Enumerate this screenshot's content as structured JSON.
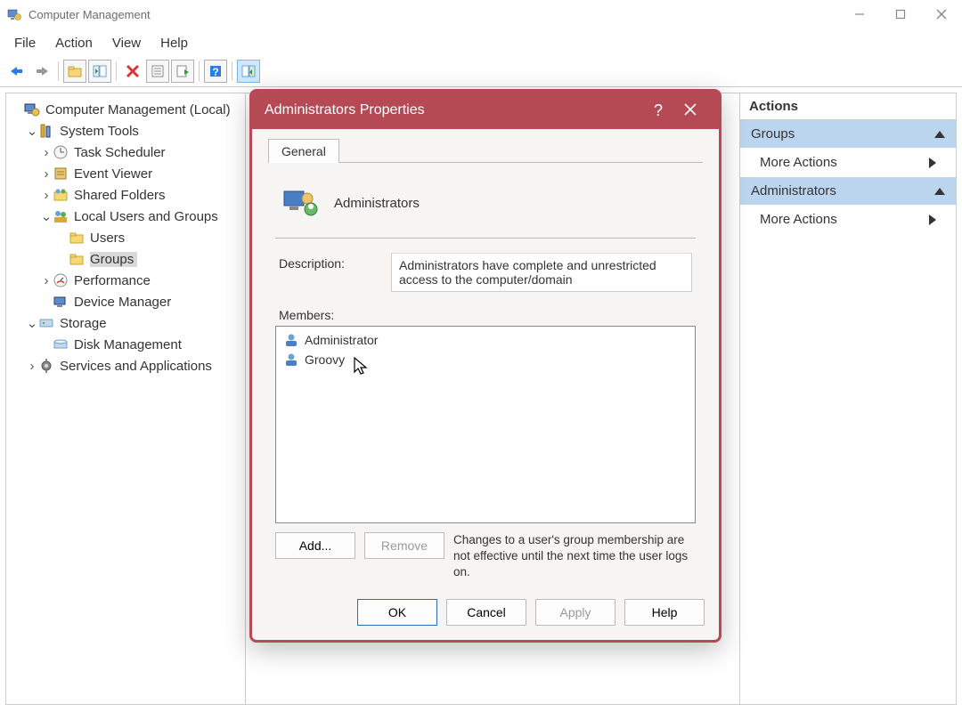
{
  "window": {
    "title": "Computer Management",
    "menus": [
      "File",
      "Action",
      "View",
      "Help"
    ]
  },
  "tree": {
    "root": "Computer Management (Local)",
    "system_tools": "System Tools",
    "task_scheduler": "Task Scheduler",
    "event_viewer": "Event Viewer",
    "shared_folders": "Shared Folders",
    "local_users_groups": "Local Users and Groups",
    "users": "Users",
    "groups": "Groups",
    "performance": "Performance",
    "device_manager": "Device Manager",
    "storage": "Storage",
    "disk_management": "Disk Management",
    "services_apps": "Services and Applications"
  },
  "actions": {
    "title": "Actions",
    "sections": [
      {
        "header": "Groups",
        "items": [
          "More Actions"
        ]
      },
      {
        "header": "Administrators",
        "items": [
          "More Actions"
        ]
      }
    ]
  },
  "dialog": {
    "title": "Administrators Properties",
    "tab": "General",
    "group_name": "Administrators",
    "description_label": "Description:",
    "description_value": "Administrators have complete and unrestricted access to the computer/domain",
    "members_label": "Members:",
    "members": [
      "Administrator",
      "Groovy"
    ],
    "note": "Changes to a user's group membership are not effective until the next time the user logs on.",
    "buttons": {
      "add": "Add...",
      "remove": "Remove",
      "ok": "OK",
      "cancel": "Cancel",
      "apply": "Apply",
      "help": "Help"
    }
  }
}
